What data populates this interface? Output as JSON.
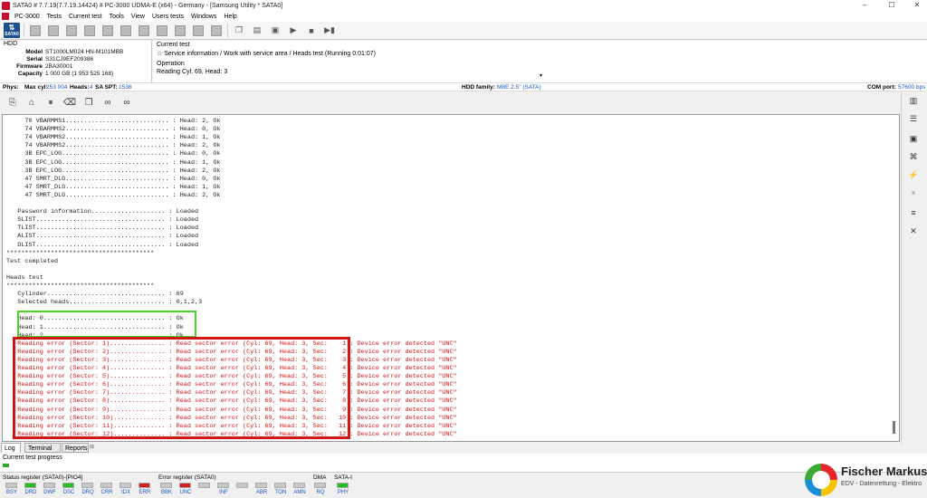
{
  "window": {
    "title": "SATA0 # 7.7.19(7.7.19.14424) # PC-3000 UDMA-E (x64) - Germany - [Samsung Utility * SATA0]",
    "min": "–",
    "max": "☐",
    "close": "✕"
  },
  "menu": [
    "PC-3000",
    "Tests",
    "Current test",
    "Tools",
    "View",
    "Users tests",
    "Windows",
    "Help"
  ],
  "toolbar": {
    "sata_label": "SATA0"
  },
  "hdd": {
    "section": "HDD",
    "model_k": "Model",
    "model": "ST1000LM024 HN-M101MBB",
    "serial_k": "Serial",
    "serial": "S31CJ9EF209386",
    "firmware_k": "Firmware",
    "firmware": "2BA30001",
    "capacity_k": "Capacity",
    "capacity": "1 000 GB (1 953 525 168)"
  },
  "current_test": {
    "label": "Current test",
    "value": "Service information / Work with service area / Heads test (Running 0:01:07)",
    "op_label": "Operation",
    "op_value": "Reading Cyl: 69, Head: 3"
  },
  "phys": {
    "label": "Phys:",
    "maxcyl_k": "Max cyl:",
    "maxcyl": "253 004",
    "heads_k": "Heads:",
    "heads": "4",
    "spt_k": "SA SPT:",
    "spt": "1536",
    "family_k": "HDD family:",
    "family": "M8E 2.5\" (SATA)",
    "com_k": "COM port:",
    "com": "57600 bps"
  },
  "log": [
    "     70 VBARMMS1............................ : Head: 2, Ok",
    "     74 VBARMMS2............................ : Head: 0, Ok",
    "     74 VBARMMS2............................ : Head: 1, Ok",
    "     74 VBARMMS2............................ : Head: 2, Ok",
    "     3B EPC_LOG............................. : Head: 0, Ok",
    "     3B EPC_LOG............................. : Head: 1, Ok",
    "     3B EPC_LOG............................. : Head: 2, Ok",
    "     47 SMRT_DLG............................ : Head: 0, Ok",
    "     47 SMRT_DLG............................ : Head: 1, Ok",
    "     47 SMRT_DLG............................ : Head: 2, Ok",
    "",
    "   Password information.................... : Loaded",
    "   SLIST................................... : Loaded",
    "   TLIST................................... : Loaded",
    "   ALIST................................... : Loaded",
    "   DLIST................................... : Loaded",
    "****************************************",
    "Test completed",
    "",
    "Heads test",
    "****************************************",
    "   Cylinder................................ : 69",
    "   Selected heads.......................... : 0,1,2,3",
    "",
    "   Head: 0................................. : Ok",
    "   Head: 1................................. : Ok",
    "   Head: 2................................. : Ok"
  ],
  "errors": [
    "   Reading error (Sector: 1)............... : Read sector error (Cyl: 69, Head: 3, Sec:    1): Device error detected \"UNC\"",
    "   Reading error (Sector: 2)............... : Read sector error (Cyl: 69, Head: 3, Sec:    2): Device error detected \"UNC\"",
    "   Reading error (Sector: 3)............... : Read sector error (Cyl: 69, Head: 3, Sec:    3): Device error detected \"UNC\"",
    "   Reading error (Sector: 4)............... : Read sector error (Cyl: 69, Head: 3, Sec:    4): Device error detected \"UNC\"",
    "   Reading error (Sector: 5)............... : Read sector error (Cyl: 69, Head: 3, Sec:    5): Device error detected \"UNC\"",
    "   Reading error (Sector: 6)............... : Read sector error (Cyl: 69, Head: 3, Sec:    6): Device error detected \"UNC\"",
    "   Reading error (Sector: 7)............... : Read sector error (Cyl: 69, Head: 3, Sec:    7): Device error detected \"UNC\"",
    "   Reading error (Sector: 8)............... : Read sector error (Cyl: 69, Head: 3, Sec:    8): Device error detected \"UNC\"",
    "   Reading error (Sector: 9)............... : Read sector error (Cyl: 69, Head: 3, Sec:    9): Device error detected \"UNC\"",
    "   Reading error (Sector: 10).............. : Read sector error (Cyl: 69, Head: 3, Sec:   10): Device error detected \"UNC\"",
    "   Reading error (Sector: 11).............. : Read sector error (Cyl: 69, Head: 3, Sec:   11): Device error detected \"UNC\"",
    "   Reading error (Sector: 12).............. : Read sector error (Cyl: 69, Head: 3, Sec:   12): Device error detected \"UNC\""
  ],
  "tabs": [
    "Log",
    "Terminal",
    "Reports"
  ],
  "progress": {
    "label": "Current test progress",
    "value": 0.01
  },
  "status": {
    "status_title": "Status register (SATA0)-[PIO4]",
    "error_title": "Error register (SATA0)",
    "dma_title": "DMA",
    "satai_title": "SATA-I",
    "status_leds": [
      {
        "n": "BSY",
        "c": "gray"
      },
      {
        "n": "DRD",
        "c": "green"
      },
      {
        "n": "DWF",
        "c": "gray"
      },
      {
        "n": "DSC",
        "c": "green"
      },
      {
        "n": "DRQ",
        "c": "gray"
      },
      {
        "n": "CRR",
        "c": "gray"
      },
      {
        "n": "IDX",
        "c": "gray"
      },
      {
        "n": "ERR",
        "c": "red"
      }
    ],
    "error_leds": [
      {
        "n": "BBK",
        "c": "gray"
      },
      {
        "n": "UNC",
        "c": "red"
      },
      {
        "n": "",
        "c": "gray"
      },
      {
        "n": "INF",
        "c": "gray"
      },
      {
        "n": "",
        "c": "gray"
      },
      {
        "n": "ABR",
        "c": "gray"
      },
      {
        "n": "TON",
        "c": "gray"
      },
      {
        "n": "AMN",
        "c": "gray"
      }
    ],
    "dma_leds": [
      {
        "n": "RQ",
        "c": "gray"
      }
    ],
    "satai_leds": [
      {
        "n": "PHY",
        "c": "green"
      }
    ]
  },
  "watermark": {
    "name": "Fischer Markus",
    "sub": "EDV - Datenrettung - Elektro"
  }
}
